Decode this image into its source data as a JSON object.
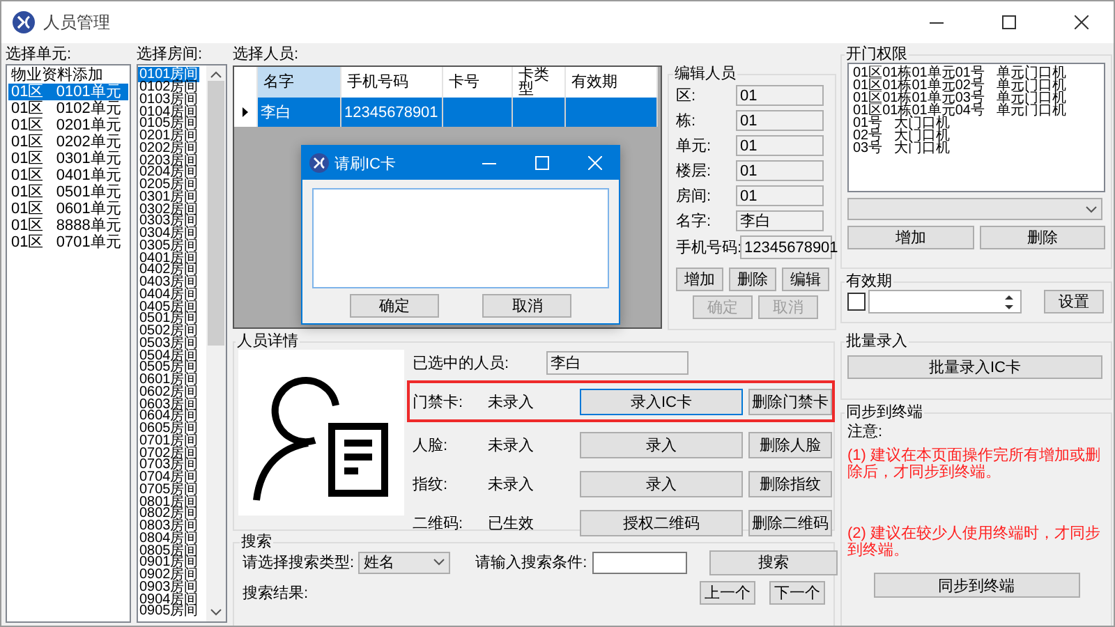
{
  "window": {
    "title": "人员管理"
  },
  "units": {
    "label": "选择单元:",
    "items": [
      {
        "text": "物业资料添加",
        "selected": false
      },
      {
        "text": "01区   0101单元",
        "selected": true
      },
      {
        "text": "01区   0102单元",
        "selected": false
      },
      {
        "text": "01区   0201单元",
        "selected": false
      },
      {
        "text": "01区   0202单元",
        "selected": false
      },
      {
        "text": "01区   0301单元",
        "selected": false
      },
      {
        "text": "01区   0401单元",
        "selected": false
      },
      {
        "text": "01区   0501单元",
        "selected": false
      },
      {
        "text": "01区   0601单元",
        "selected": false
      },
      {
        "text": "01区   8888单元",
        "selected": false
      },
      {
        "text": "01区   0701单元",
        "selected": false
      }
    ]
  },
  "rooms": {
    "label": "选择房间:",
    "items": [
      {
        "text": "0101房间",
        "selected": true
      },
      {
        "text": "0102房间",
        "selected": false
      },
      {
        "text": "0103房间",
        "selected": false
      },
      {
        "text": "0104房间",
        "selected": false
      },
      {
        "text": "0105房间",
        "selected": false
      },
      {
        "text": "0201房间",
        "selected": false
      },
      {
        "text": "0202房间",
        "selected": false
      },
      {
        "text": "0203房间",
        "selected": false
      },
      {
        "text": "0204房间",
        "selected": false
      },
      {
        "text": "0205房间",
        "selected": false
      },
      {
        "text": "0301房间",
        "selected": false
      },
      {
        "text": "0302房间",
        "selected": false
      },
      {
        "text": "0303房间",
        "selected": false
      },
      {
        "text": "0304房间",
        "selected": false
      },
      {
        "text": "0305房间",
        "selected": false
      },
      {
        "text": "0401房间",
        "selected": false
      },
      {
        "text": "0402房间",
        "selected": false
      },
      {
        "text": "0403房间",
        "selected": false
      },
      {
        "text": "0404房间",
        "selected": false
      },
      {
        "text": "0405房间",
        "selected": false
      },
      {
        "text": "0501房间",
        "selected": false
      },
      {
        "text": "0502房间",
        "selected": false
      },
      {
        "text": "0503房间",
        "selected": false
      },
      {
        "text": "0504房间",
        "selected": false
      },
      {
        "text": "0505房间",
        "selected": false
      },
      {
        "text": "0601房间",
        "selected": false
      },
      {
        "text": "0602房间",
        "selected": false
      },
      {
        "text": "0603房间",
        "selected": false
      },
      {
        "text": "0604房间",
        "selected": false
      },
      {
        "text": "0605房间",
        "selected": false
      },
      {
        "text": "0701房间",
        "selected": false
      },
      {
        "text": "0702房间",
        "selected": false
      },
      {
        "text": "0703房间",
        "selected": false
      },
      {
        "text": "0704房间",
        "selected": false
      },
      {
        "text": "0705房间",
        "selected": false
      },
      {
        "text": "0801房间",
        "selected": false
      },
      {
        "text": "0802房间",
        "selected": false
      },
      {
        "text": "0803房间",
        "selected": false
      },
      {
        "text": "0804房间",
        "selected": false
      },
      {
        "text": "0805房间",
        "selected": false
      },
      {
        "text": "0901房间",
        "selected": false
      },
      {
        "text": "0902房间",
        "selected": false
      },
      {
        "text": "0903房间",
        "selected": false
      },
      {
        "text": "0904房间",
        "selected": false
      },
      {
        "text": "0905房间",
        "selected": false
      }
    ]
  },
  "people": {
    "label": "选择人员:",
    "columns": [
      {
        "label": "名字",
        "selected": true
      },
      {
        "label": "手机号码",
        "selected": false
      },
      {
        "label": "卡号",
        "selected": false
      },
      {
        "label": "卡类型",
        "selected": false
      },
      {
        "label": "有效期",
        "selected": false
      }
    ],
    "rows": [
      {
        "cells": [
          "李白",
          "12345678901",
          "",
          "",
          ""
        ],
        "selected": true
      }
    ]
  },
  "dialog": {
    "title": "请刷IC卡",
    "buttons": [
      "确定",
      "取消"
    ]
  },
  "edit_person": {
    "title": "编辑人员",
    "fields": [
      {
        "label": "区:",
        "value": "01"
      },
      {
        "label": "栋:",
        "value": "01"
      },
      {
        "label": "单元:",
        "value": "01"
      },
      {
        "label": "楼层:",
        "value": "01"
      },
      {
        "label": "房间:",
        "value": "01"
      },
      {
        "label": "名字:",
        "value": "李白"
      },
      {
        "label": "手机号码:",
        "value": "12345678901"
      }
    ],
    "buttons": [
      {
        "label": "增加",
        "disabled": false
      },
      {
        "label": "删除",
        "disabled": false
      },
      {
        "label": "编辑",
        "disabled": false
      },
      {
        "label": "确定",
        "disabled": true
      },
      {
        "label": "取消",
        "disabled": true
      }
    ]
  },
  "details": {
    "title": "人员详情",
    "selected_label": "已选中的人员:",
    "selected_value": "李白",
    "rows": [
      {
        "label": "门禁卡:",
        "status": "未录入",
        "action": "录入IC卡",
        "remove": "删除门禁卡",
        "highlighted": true,
        "focused": true
      },
      {
        "label": "人脸:",
        "status": "未录入",
        "action": "录入",
        "remove": "删除人脸",
        "highlighted": false,
        "focused": false
      },
      {
        "label": "指纹:",
        "status": "未录入",
        "action": "录入",
        "remove": "删除指纹",
        "highlighted": false,
        "focused": false
      },
      {
        "label": "二维码:",
        "status": "已生效",
        "action": "授权二维码",
        "remove": "删除二维码",
        "highlighted": false,
        "focused": false
      }
    ]
  },
  "search": {
    "title": "搜索",
    "type_label": "请选择搜索类型:",
    "type_value": "姓名",
    "query_label": "请输入搜索条件:",
    "button": "搜索",
    "results_label": "搜索结果:",
    "prev": "上一个",
    "next": "下一个"
  },
  "permissions": {
    "title": "开门权限",
    "items": [
      "01区01栋01单元01号   单元门口机",
      "01区01栋01单元02号   单元门口机",
      "01区01栋01单元03号   单元门口机",
      "01区01栋01单元04号   单元门口机",
      "01号   大门口机",
      "02号   大门口机",
      "03号   大门口机"
    ],
    "buttons": [
      "增加",
      "删除"
    ]
  },
  "validity": {
    "title": "有效期",
    "checked": false,
    "button": "设置"
  },
  "batch": {
    "title": "批量录入",
    "button": "批量录入IC卡"
  },
  "sync": {
    "title": "同步到终端",
    "note_label": "注意:",
    "notes": [
      "(1) 建议在本页面操作完所有增加或删除后，才同步到终端。",
      "(2) 建议在较少人使用终端时，才同步到终端。"
    ],
    "button": "同步到终端"
  }
}
